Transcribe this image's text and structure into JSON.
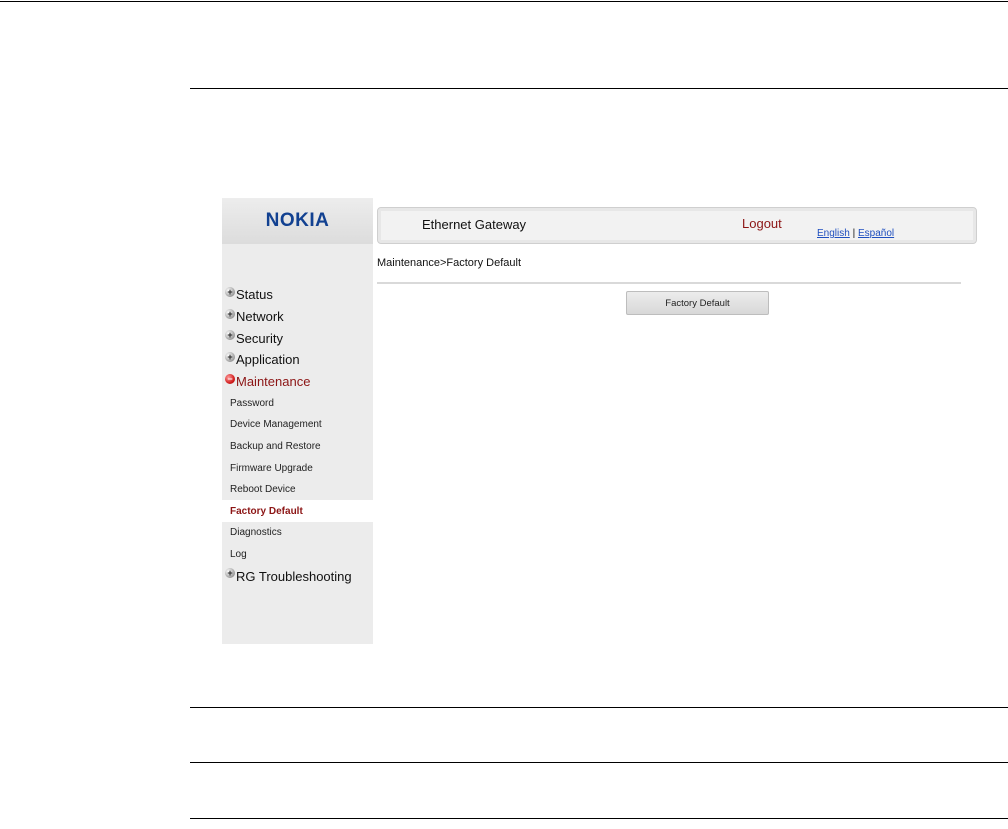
{
  "app": {
    "logo_text": "NOKIA",
    "header_title": "Ethernet Gateway",
    "logout_label": "Logout",
    "lang_english": "English",
    "lang_separator": "|",
    "lang_spanish": "Español"
  },
  "breadcrumb": "Maintenance>Factory Default",
  "main": {
    "factory_default_button": "Factory Default"
  },
  "sidebar": {
    "items": [
      {
        "label": "Status"
      },
      {
        "label": "Network"
      },
      {
        "label": "Security"
      },
      {
        "label": "Application"
      },
      {
        "label": "Maintenance"
      },
      {
        "label": "RG Troubleshooting"
      }
    ],
    "maintenance_sub": [
      {
        "label": "Password"
      },
      {
        "label": "Device Management"
      },
      {
        "label": "Backup and Restore"
      },
      {
        "label": "Firmware Upgrade"
      },
      {
        "label": "Reboot Device"
      },
      {
        "label": "Factory Default"
      },
      {
        "label": "Diagnostics"
      },
      {
        "label": "Log"
      }
    ]
  },
  "colors": {
    "brand_blue": "#124191",
    "active_red": "#8c1515",
    "link_blue": "#1f4fbf"
  }
}
